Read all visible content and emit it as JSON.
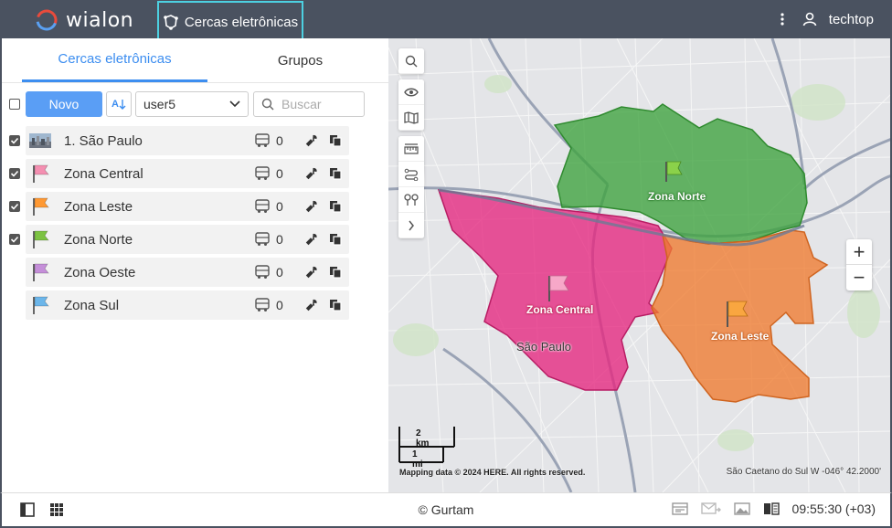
{
  "header": {
    "logo_text": "wialon",
    "active_tab": "Cercas eletrônicas",
    "username": "techtop"
  },
  "panel": {
    "tabs": [
      "Cercas eletrônicas",
      "Grupos"
    ],
    "new_button": "Novo",
    "sort_label": "A",
    "resource_select": "user5",
    "search_placeholder": "Buscar"
  },
  "geofences": [
    {
      "name": "1. São Paulo",
      "count": "0",
      "checked": true,
      "icon": "city-thumbnail"
    },
    {
      "name": "Zona Central",
      "count": "0",
      "checked": true,
      "icon": "flag-pink",
      "color": "#f48fb1"
    },
    {
      "name": "Zona Leste",
      "count": "0",
      "checked": true,
      "icon": "flag-orange",
      "color": "#ff9933"
    },
    {
      "name": "Zona Norte",
      "count": "0",
      "checked": true,
      "icon": "flag-green",
      "color": "#7cc242"
    },
    {
      "name": "Zona Oeste",
      "count": "0",
      "checked": false,
      "icon": "flag-purple",
      "color": "#c58fd9"
    },
    {
      "name": "Zona Sul",
      "count": "0",
      "checked": false,
      "icon": "flag-blue",
      "color": "#6cb6ea"
    }
  ],
  "map": {
    "zones": [
      {
        "name": "Zona Norte",
        "color": "#3a9a3a"
      },
      {
        "name": "Zona Central",
        "color": "#e0287a"
      },
      {
        "name": "Zona Leste",
        "color": "#f07b2f"
      }
    ],
    "city_label": "São Paulo",
    "scale_km": "2 km",
    "scale_mi": "1 mi",
    "copyright": "Mapping data © 2024 HERE. All rights reserved.",
    "coords": "São Caetano do Sul W -046° 42.2000'",
    "zoom_in": "+",
    "zoom_out": "−"
  },
  "footer": {
    "copyright": "© Gurtam",
    "clock": "09:55:30 (+03)"
  }
}
